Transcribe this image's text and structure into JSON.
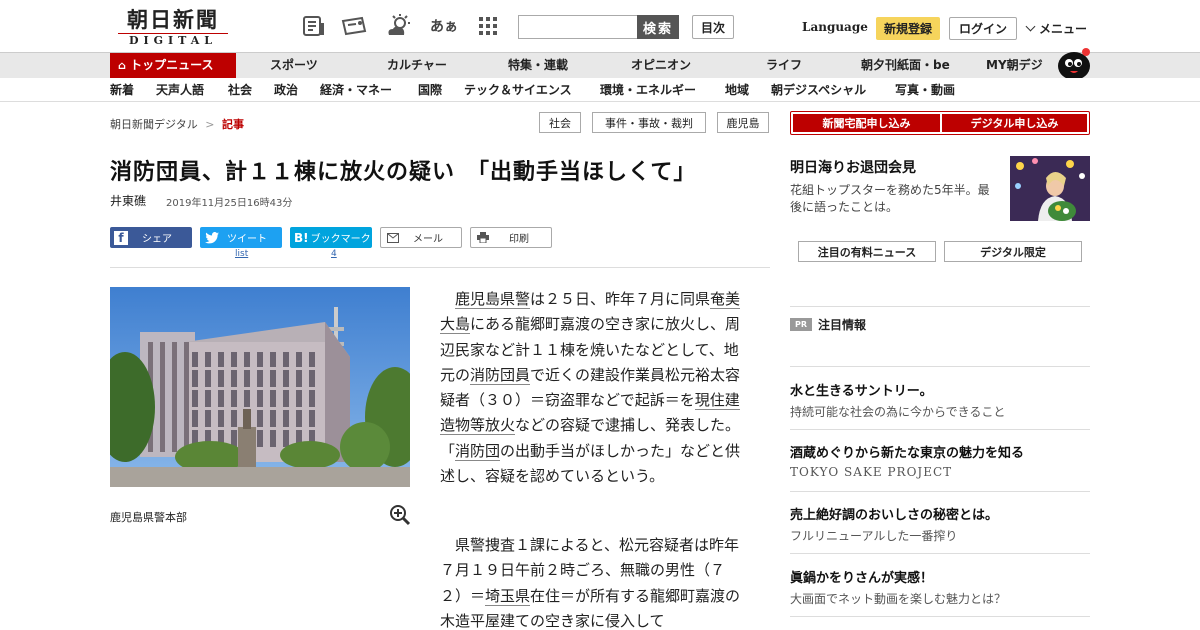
{
  "header": {
    "logo_main": "朝日新聞",
    "logo_sub": "DIGITAL",
    "search_button": "検索",
    "toc_button": "目次",
    "language": "Language",
    "register": "新規登録",
    "login": "ログイン",
    "menu": "メニュー",
    "kana_icon_text": "あぁ"
  },
  "nav_primary": [
    "トップニュース",
    "スポーツ",
    "カルチャー",
    "特集・連載",
    "オピニオン",
    "ライフ",
    "朝夕刊紙面・be",
    "MY朝デジ"
  ],
  "nav_secondary": [
    "新着",
    "天声人語",
    "社会",
    "政治",
    "経済・マネー",
    "国際",
    "テック＆サイエンス",
    "環境・エネルギー",
    "地域",
    "朝デジスペシャル",
    "写真・動画"
  ],
  "breadcrumb": {
    "home": "朝日新聞デジタル",
    "sep": ">",
    "current": "記事"
  },
  "tags": [
    "社会",
    "事件・事故・裁判",
    "鹿児島"
  ],
  "article": {
    "title": "消防団員、計１１棟に放火の疑い　「出動手当ほしくて」",
    "author": "井東礁",
    "date": "2019年11月25日16時43分",
    "share": {
      "facebook": "シェア",
      "twitter": "ツイート",
      "hatena": "ブックマーク",
      "mail": "メール",
      "print": "印刷",
      "twitter_count": "list",
      "hatena_count": "4"
    },
    "photo_caption": "鹿児島県警本部",
    "p1": {
      "a": "　",
      "l1": "鹿児島県警",
      "b": "は２５日、昨年７月に同県",
      "l2": "奄美大島",
      "c": "にある龍郷町嘉渡の空き家に放火し、周辺民家など計１１棟を焼いたなどとして、地元の",
      "l3": "消防団員",
      "d": "で近くの建設作業員松元裕太容疑者（３０）＝窃盗罪などで起訴＝を",
      "l4": "現住建造物等放火",
      "e": "などの容疑で逮捕し、発表した。「",
      "l5": "消防団",
      "f": "の出動手当がほしかった」などと供述し、容疑を認めているという。"
    },
    "p2": {
      "a": "　県警捜査１課によると、松元容疑者は昨年７月１９日午前２時ごろ、無職の男性（７２）＝",
      "l1": "埼玉県",
      "b": "在住＝が所有する龍郷町嘉渡の木造平屋建ての空き家に侵入して"
    }
  },
  "sidebar": {
    "subscribe_paper": "新聞宅配申し込み",
    "subscribe_digital": "デジタル申し込み",
    "feature_title": "明日海りお退団会見",
    "feature_desc": "花組トップスターを務めた5年半。最後に語ったことは。",
    "pick_paid": "注目の有料ニュース",
    "pick_digital": "デジタル限定",
    "pr_badge": "PR",
    "pr_title": "注目情報",
    "ads": [
      {
        "title": "水と生きるサントリー。",
        "sub": "持続可能な社会の為に今からできること"
      },
      {
        "title": "酒蔵めぐりから新たな東京の魅力を知る",
        "sub": "TOKYO SAKE PROJECT"
      },
      {
        "title": "売上絶好調のおいしさの秘密とは。",
        "sub": "フルリニューアルした一番搾り"
      },
      {
        "title": "眞鍋かをりさんが実感！",
        "sub": "大画面でネット動画を楽しむ魅力とは？"
      }
    ]
  },
  "colors": {
    "brand_red": "#bd0000",
    "register_yellow": "#f6d45c",
    "facebook": "#3b5998",
    "twitter": "#1da1f2",
    "hatena": "#00a4de"
  }
}
